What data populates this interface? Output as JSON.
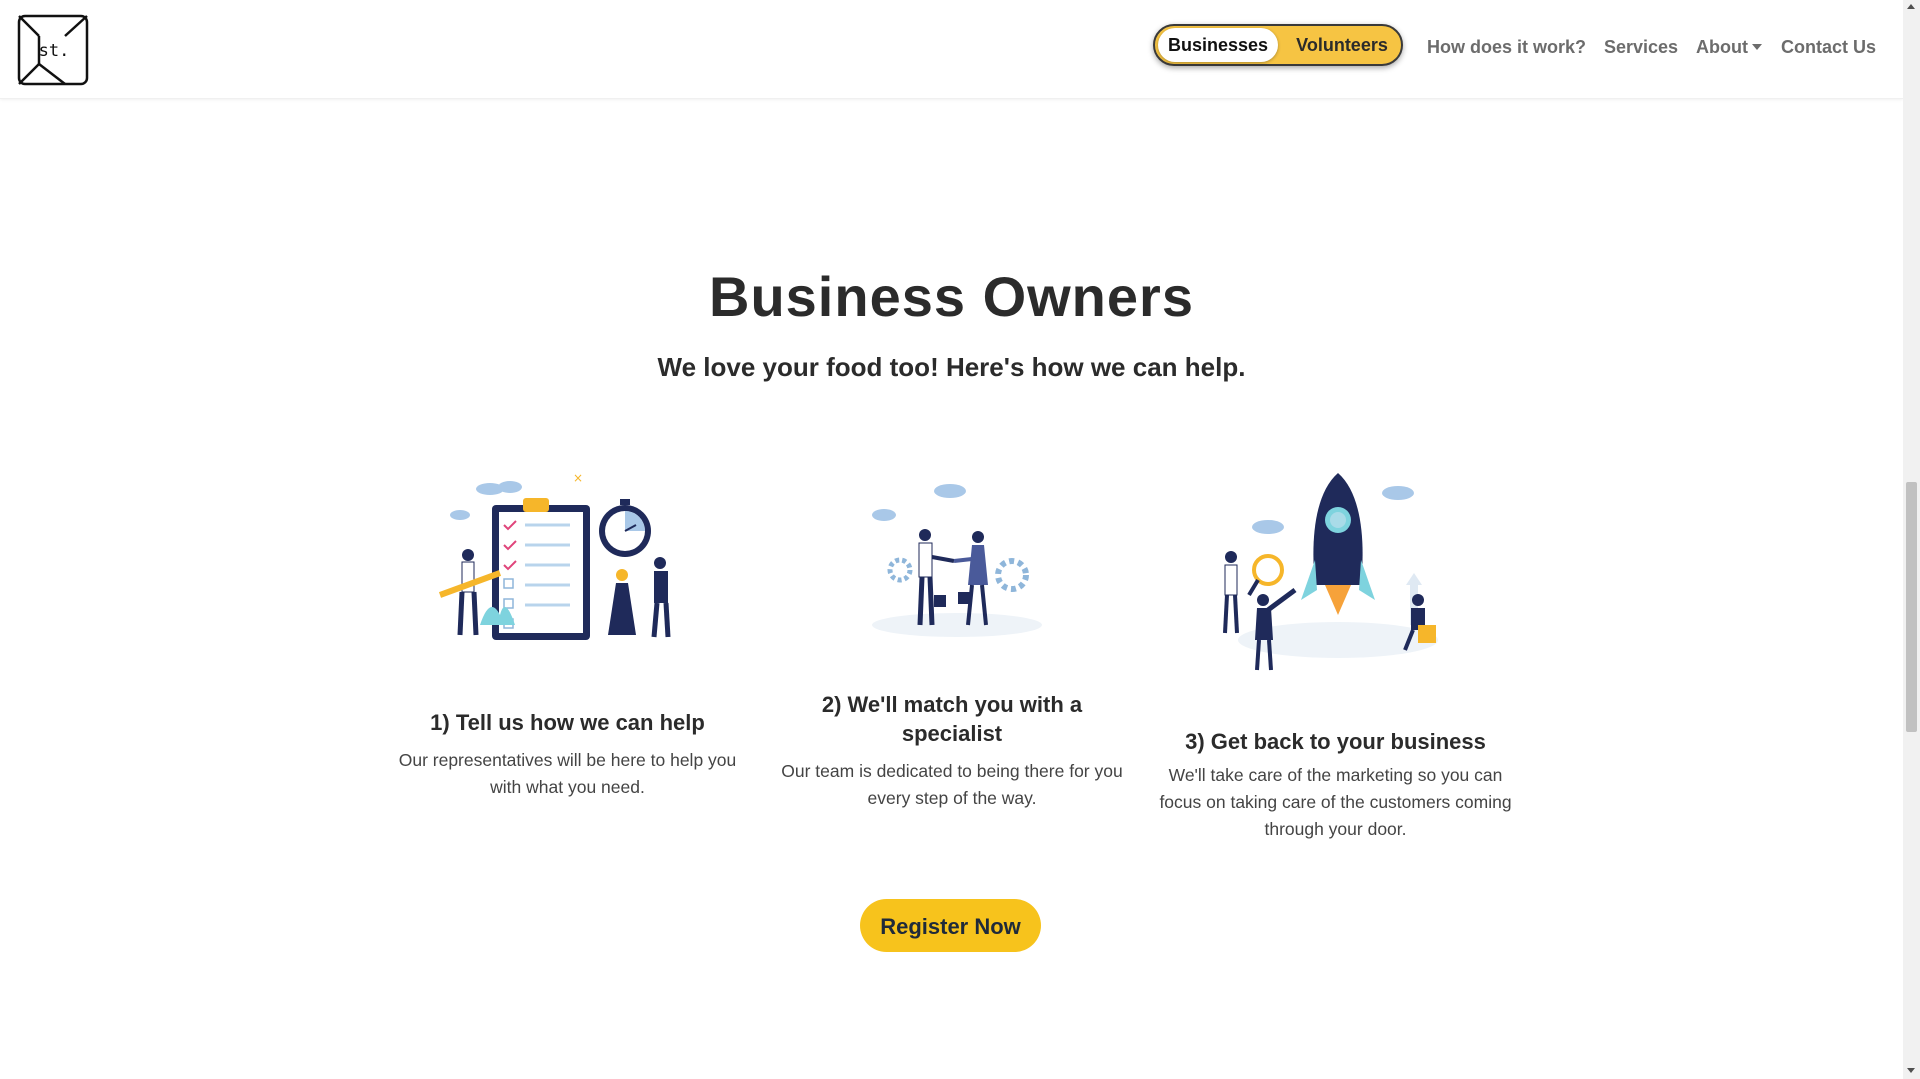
{
  "logo": {
    "text": "st."
  },
  "nav": {
    "toggle": {
      "active": "Businesses",
      "other": "Volunteers"
    },
    "links": {
      "how": "How does it work?",
      "services": "Services",
      "about": "About",
      "contact": "Contact Us"
    }
  },
  "main": {
    "title": "Business Owners",
    "subtitle": "We love your food too! Here's how we can help.",
    "steps": [
      {
        "title": "1) Tell us how we can help",
        "text": "Our representatives will be here to help you with what you need."
      },
      {
        "title": "2) We'll match you with a specialist",
        "text": "Our team is dedicated to being there for you every step of the way."
      },
      {
        "title": "3) Get back to your business",
        "text": "We'll take care of the marketing so you can focus on taking care of the customers coming through your door."
      }
    ],
    "cta": "Register Now"
  },
  "colors": {
    "accent": "#f7c31c",
    "navy": "#1f2a5a",
    "text": "#2b2b2b"
  }
}
